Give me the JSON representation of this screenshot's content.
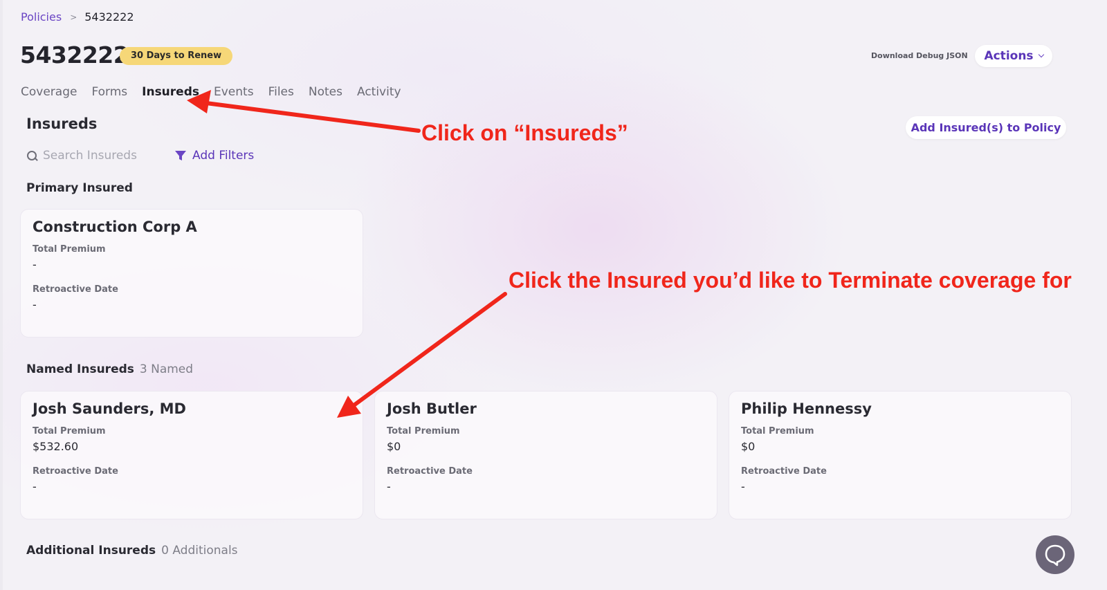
{
  "breadcrumb": {
    "root": "Policies",
    "separator": ">",
    "current": "5432222"
  },
  "header": {
    "policy_number": "5432222",
    "badge": "30 Days to Renew",
    "debug_link": "Download Debug JSON",
    "actions_label": "Actions"
  },
  "tabs": [
    "Coverage",
    "Forms",
    "Insureds",
    "Events",
    "Files",
    "Notes",
    "Activity"
  ],
  "active_tab": "Insureds",
  "insureds": {
    "title": "Insureds",
    "add_button": "Add Insured(s) to Policy",
    "search_placeholder": "Search Insureds",
    "filters_label": "Add Filters",
    "primary": {
      "heading": "Primary Insured",
      "card": {
        "name": "Construction Corp A",
        "premium_label": "Total Premium",
        "premium": "-",
        "retro_label": "Retroactive Date",
        "retro": "-"
      }
    },
    "named": {
      "heading": "Named Insureds",
      "count": "3 Named",
      "cards": [
        {
          "name": "Josh Saunders, MD",
          "premium_label": "Total Premium",
          "premium": "$532.60",
          "retro_label": "Retroactive Date",
          "retro": "-"
        },
        {
          "name": "Josh Butler",
          "premium_label": "Total Premium",
          "premium": "$0",
          "retro_label": "Retroactive Date",
          "retro": "-"
        },
        {
          "name": "Philip Hennessy",
          "premium_label": "Total Premium",
          "premium": "$0",
          "retro_label": "Retroactive Date",
          "retro": "-"
        }
      ]
    },
    "additional": {
      "heading": "Additional Insureds",
      "count": "0 Additionals"
    }
  },
  "annotations": {
    "first": "Click on “Insureds”",
    "second": "Click the Insured you’d like to Terminate coverage for"
  },
  "icons": {
    "search": "search-icon",
    "filter": "filter-icon",
    "chevron": "chevron-down-icon",
    "chat": "chat-bubble-icon"
  },
  "colors": {
    "accent": "#5a35b8",
    "badge": "#f6d778",
    "annotation": "#f0261b",
    "chat_button": "#6b6578"
  }
}
